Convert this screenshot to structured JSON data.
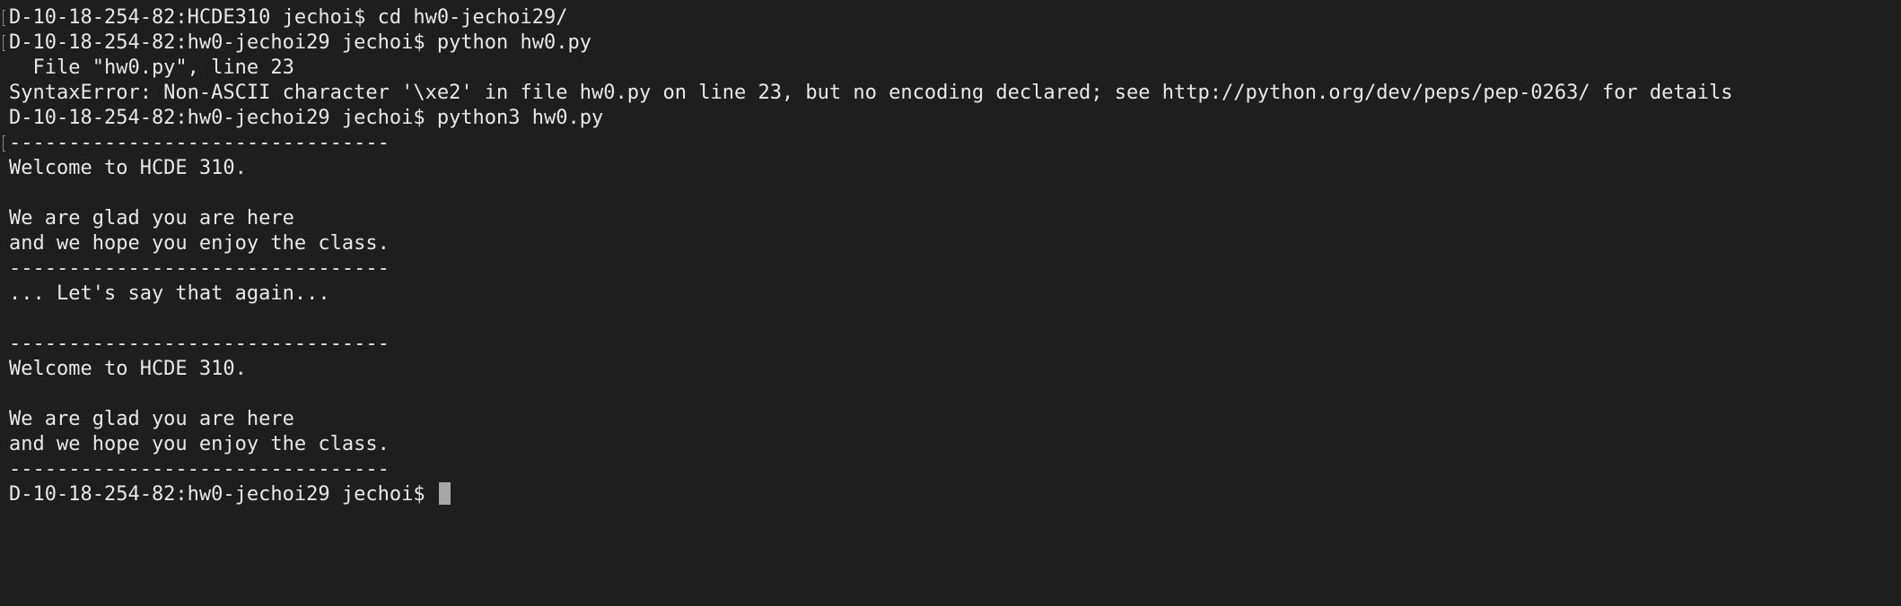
{
  "terminal": {
    "lines": [
      "D-10-18-254-82:HCDE310 jechoi$ cd hw0-jechoi29/",
      "D-10-18-254-82:hw0-jechoi29 jechoi$ python hw0.py",
      "  File \"hw0.py\", line 23",
      "SyntaxError: Non-ASCII character '\\xe2' in file hw0.py on line 23, but no encoding declared; see http://python.org/dev/peps/pep-0263/ for details",
      "D-10-18-254-82:hw0-jechoi29 jechoi$ python3 hw0.py",
      "--------------------------------",
      "Welcome to HCDE 310.",
      "",
      "We are glad you are here",
      "and we hope you enjoy the class.",
      "--------------------------------",
      "... Let's say that again...",
      "",
      "--------------------------------",
      "Welcome to HCDE 310.",
      "",
      "We are glad you are here",
      "and we hope you enjoy the class.",
      "--------------------------------"
    ],
    "prompt": "D-10-18-254-82:hw0-jechoi29 jechoi$ "
  }
}
